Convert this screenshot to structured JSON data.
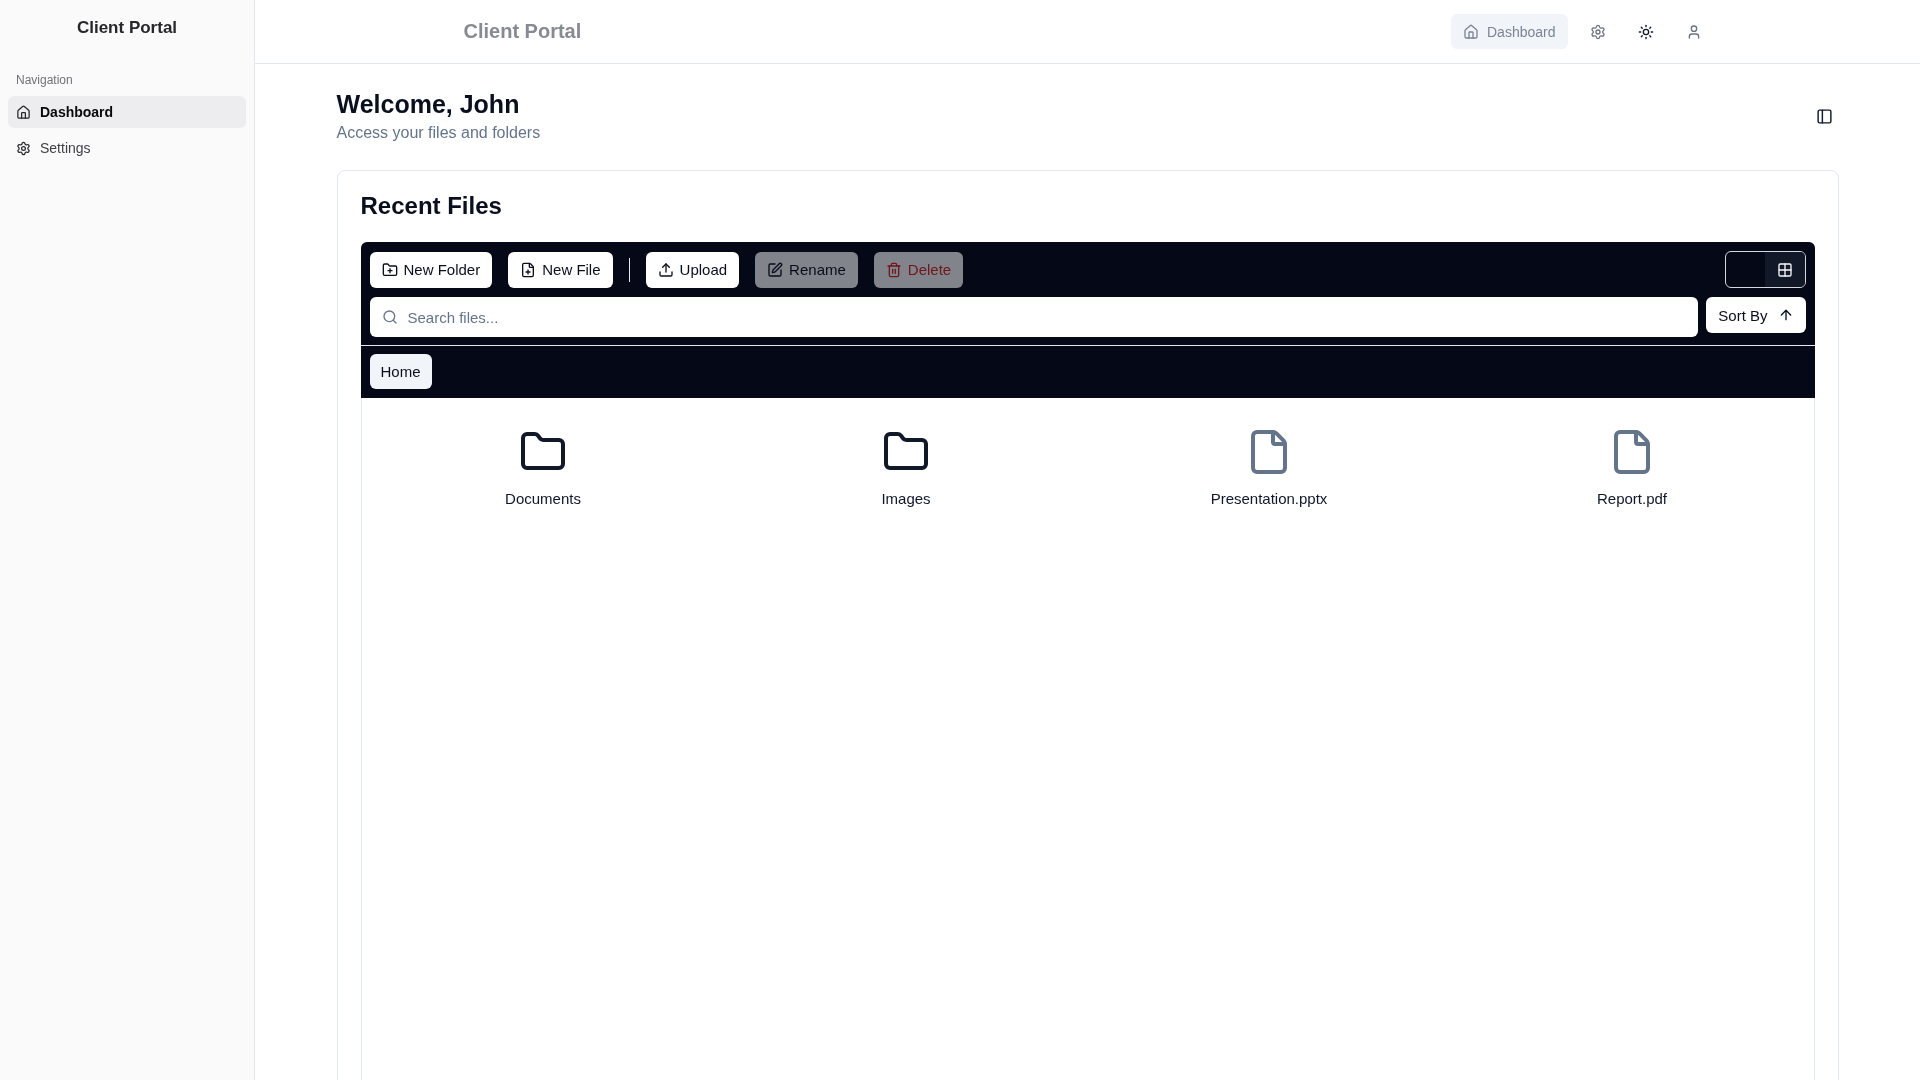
{
  "sidebar": {
    "title": "Client Portal",
    "section_label": "Navigation",
    "items": [
      {
        "label": "Dashboard",
        "selected": true
      },
      {
        "label": "Settings",
        "selected": false
      }
    ]
  },
  "header": {
    "title": "Client Portal",
    "nav": [
      {
        "label": "Dashboard",
        "selected": true
      }
    ]
  },
  "page": {
    "title": "Welcome, John",
    "subtitle": "Access your files and folders"
  },
  "card": {
    "title": "Recent Files",
    "action_groups": [
      [
        {
          "label": "New Folder",
          "disabled": false,
          "kind": "default"
        },
        {
          "label": "New File",
          "disabled": false,
          "kind": "default"
        }
      ],
      [
        {
          "label": "Upload",
          "disabled": false,
          "kind": "default"
        },
        {
          "label": "Rename",
          "disabled": true,
          "kind": "default"
        },
        {
          "label": "Delete",
          "disabled": true,
          "kind": "danger"
        }
      ]
    ],
    "view_toggle": {
      "grid_selected": true
    },
    "search": {
      "placeholder": "Search files..."
    },
    "sort": {
      "label": "Sort By",
      "ascending": true
    },
    "breadcrumbs": [
      {
        "label": "Home"
      }
    ],
    "files": [
      {
        "name": "Documents",
        "kind": "folder"
      },
      {
        "name": "Images",
        "kind": "folder"
      },
      {
        "name": "Presentation.pptx",
        "kind": "file"
      },
      {
        "name": "Report.pdf",
        "kind": "file"
      }
    ]
  }
}
